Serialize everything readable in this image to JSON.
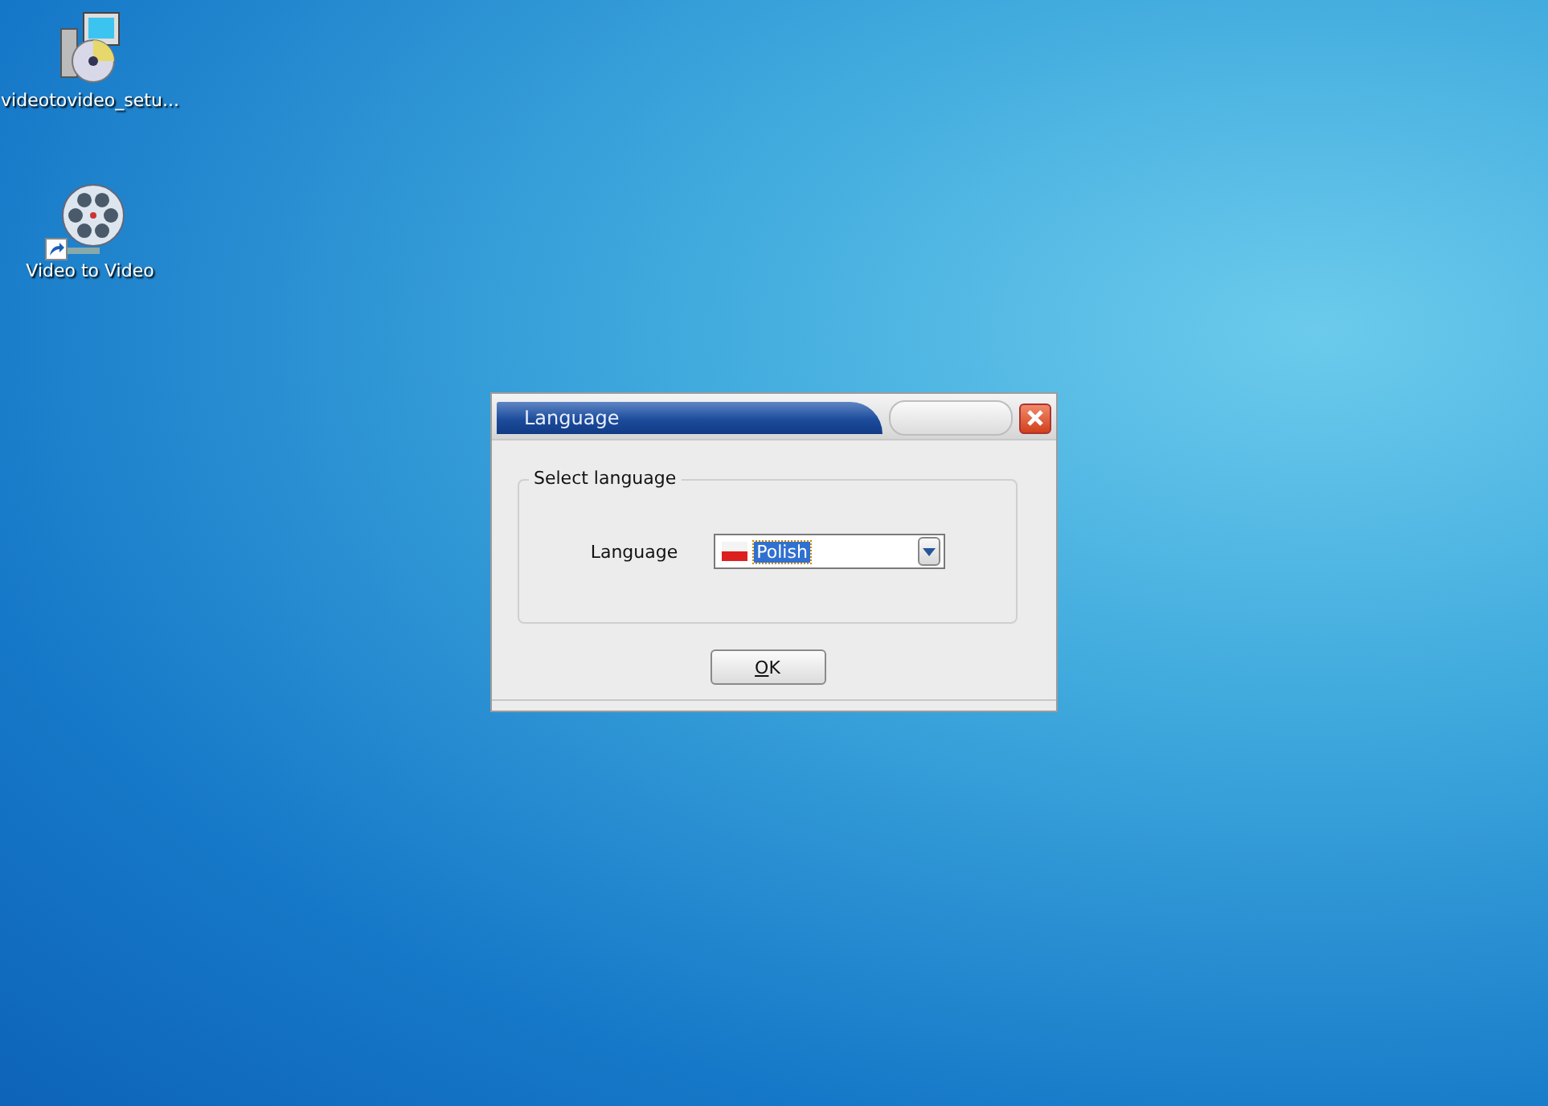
{
  "desktop_icons": [
    {
      "label": "videotovideo_setu...",
      "kind": "installer",
      "shortcut": false
    },
    {
      "label": "Video to Video",
      "kind": "film-reel",
      "shortcut": true
    }
  ],
  "dialog": {
    "title": "Language",
    "group_title": "Select language",
    "field_label": "Language",
    "language": {
      "value": "Polish",
      "text_selected": true
    },
    "ok_button": "OK"
  }
}
